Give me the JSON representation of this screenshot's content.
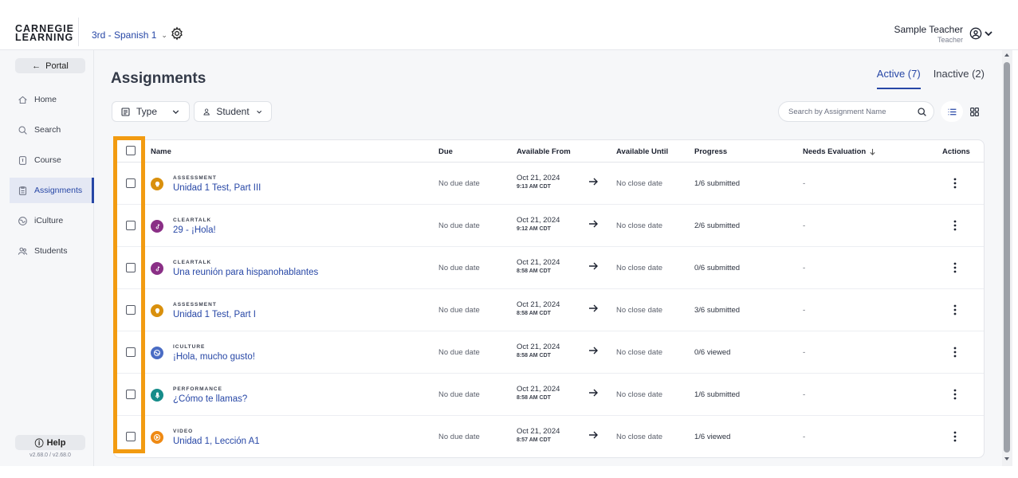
{
  "header": {
    "logo_line1": "CARNEGIE",
    "logo_line2": "LEARNING",
    "course": "3rd - Spanish 1",
    "user_name": "Sample Teacher",
    "user_role": "Teacher"
  },
  "sidebar": {
    "portal_label": "Portal",
    "items": [
      {
        "label": "Home",
        "icon": "home-icon"
      },
      {
        "label": "Search",
        "icon": "search-icon"
      },
      {
        "label": "Course",
        "icon": "course-icon"
      },
      {
        "label": "Assignments",
        "icon": "assignments-icon",
        "active": true
      },
      {
        "label": "iCulture",
        "icon": "iculture-icon"
      },
      {
        "label": "Students",
        "icon": "students-icon"
      }
    ],
    "help_label": "Help",
    "version": "v2.68.0 / v2.68.0"
  },
  "main": {
    "title": "Assignments",
    "tabs": [
      {
        "label": "Active (7)",
        "active": true
      },
      {
        "label": "Inactive (2)",
        "active": false
      }
    ],
    "filters": {
      "type_label": "Type",
      "student_label": "Student"
    },
    "search": {
      "placeholder": "Search by Assignment Name",
      "value": ""
    },
    "columns": {
      "name": "Name",
      "due": "Due",
      "available_from": "Available From",
      "available_until": "Available Until",
      "progress": "Progress",
      "needs_evaluation": "Needs Evaluation",
      "actions": "Actions"
    },
    "rows": [
      {
        "type": "ASSESSMENT",
        "name": "Unidad 1 Test, Part III",
        "due": "No due date",
        "from_date": "Oct 21, 2024",
        "from_time": "9:13 AM CDT",
        "until": "No close date",
        "progress": "1/6 submitted",
        "needs": "-"
      },
      {
        "type": "CLEARTALK",
        "name": "29 - ¡Hola!",
        "due": "No due date",
        "from_date": "Oct 21, 2024",
        "from_time": "9:12 AM CDT",
        "until": "No close date",
        "progress": "2/6 submitted",
        "needs": "-"
      },
      {
        "type": "CLEARTALK",
        "name": "Una reunión para hispanohablantes",
        "due": "No due date",
        "from_date": "Oct 21, 2024",
        "from_time": "8:58 AM CDT",
        "until": "No close date",
        "progress": "0/6 submitted",
        "needs": "-"
      },
      {
        "type": "ASSESSMENT",
        "name": "Unidad 1 Test, Part I",
        "due": "No due date",
        "from_date": "Oct 21, 2024",
        "from_time": "8:58 AM CDT",
        "until": "No close date",
        "progress": "3/6 submitted",
        "needs": "-"
      },
      {
        "type": "ICULTURE",
        "name": "¡Hola, mucho gusto!",
        "due": "No due date",
        "from_date": "Oct 21, 2024",
        "from_time": "8:58 AM CDT",
        "until": "No close date",
        "progress": "0/6 viewed",
        "needs": "-"
      },
      {
        "type": "PERFORMANCE",
        "name": "¿Cómo te llamas?",
        "due": "No due date",
        "from_date": "Oct 21, 2024",
        "from_time": "8:58 AM CDT",
        "until": "No close date",
        "progress": "1/6 submitted",
        "needs": "-"
      },
      {
        "type": "VIDEO",
        "name": "Unidad 1, Lección A1",
        "due": "No due date",
        "from_date": "Oct 21, 2024",
        "from_time": "8:57 AM CDT",
        "until": "No close date",
        "progress": "1/6 viewed",
        "needs": "-"
      }
    ]
  },
  "colors": {
    "brand_blue": "#2747a6",
    "highlight_orange": "#f29b11",
    "assessment": "#d9900d",
    "cleartalk": "#8a2f86",
    "iculture": "#4a6cc4",
    "performance": "#168c8a",
    "video": "#ef8a14"
  }
}
